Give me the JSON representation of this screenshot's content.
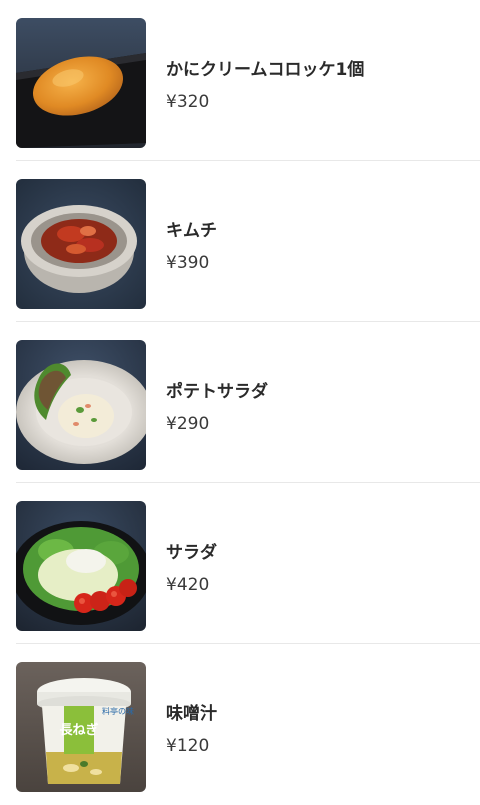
{
  "menu": {
    "items": [
      {
        "name": "かにクリームコロッケ1個",
        "price": "¥320",
        "image": "crab-cream-croquette-photo"
      },
      {
        "name": "キムチ",
        "price": "¥390",
        "image": "kimchi-photo"
      },
      {
        "name": "ポテトサラダ",
        "price": "¥290",
        "image": "potato-salad-photo"
      },
      {
        "name": "サラダ",
        "price": "¥420",
        "image": "salad-photo"
      },
      {
        "name": "味噌汁",
        "price": "¥120",
        "image": "miso-soup-photo"
      }
    ]
  },
  "packaging": {
    "brand": "料亭の味",
    "label_main": "長ねぎ"
  }
}
